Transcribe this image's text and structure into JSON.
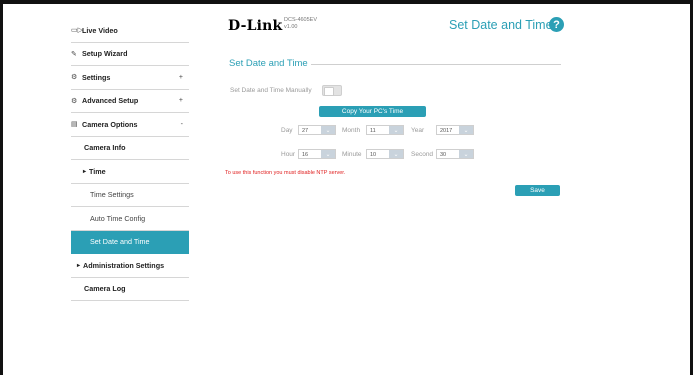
{
  "header": {
    "logo": "D-Link",
    "model": "DCS-4605EV",
    "version": "v1.00",
    "page_title": "Set Date and Time",
    "help": "?"
  },
  "sidebar": {
    "items": [
      {
        "label": "Live Video",
        "icon": "video-icon",
        "icon_glyph": "▭▷"
      },
      {
        "label": "Setup Wizard",
        "icon": "wand-icon",
        "icon_glyph": "✎"
      },
      {
        "label": "Settings",
        "icon": "gear-icon",
        "icon_glyph": "⚙",
        "expander": "+"
      },
      {
        "label": "Advanced Setup",
        "icon": "advanced-gear-icon",
        "icon_glyph": "⚙",
        "expander": "+"
      },
      {
        "label": "Camera Options",
        "icon": "camera-options-icon",
        "icon_glyph": "▤",
        "expander": "-"
      },
      {
        "label": "Camera Info"
      },
      {
        "label": "Time",
        "bullet": "▸"
      },
      {
        "label": "Time Settings"
      },
      {
        "label": "Auto Time Config"
      },
      {
        "label": "Set Date and Time",
        "active": true
      },
      {
        "label": "Administration Settings",
        "bullet": "▸"
      },
      {
        "label": "Camera Log"
      }
    ]
  },
  "section": {
    "title": "Set Date and Time",
    "manual_label": "Set Date and Time Manually",
    "manual_enabled": false,
    "copy_button": "Copy Your PC's Time",
    "fields": {
      "day": {
        "label": "Day",
        "value": "27"
      },
      "month": {
        "label": "Month",
        "value": "11"
      },
      "year": {
        "label": "Year",
        "value": "2017"
      },
      "hour": {
        "label": "Hour",
        "value": "16"
      },
      "minute": {
        "label": "Minute",
        "value": "10"
      },
      "second": {
        "label": "Second",
        "value": "30"
      }
    },
    "warning": "To use this function you must disable NTP server.",
    "save_button": "Save"
  },
  "colors": {
    "accent": "#2b9fb5",
    "warning": "#e02020",
    "muted_text": "#9a9a9a"
  }
}
